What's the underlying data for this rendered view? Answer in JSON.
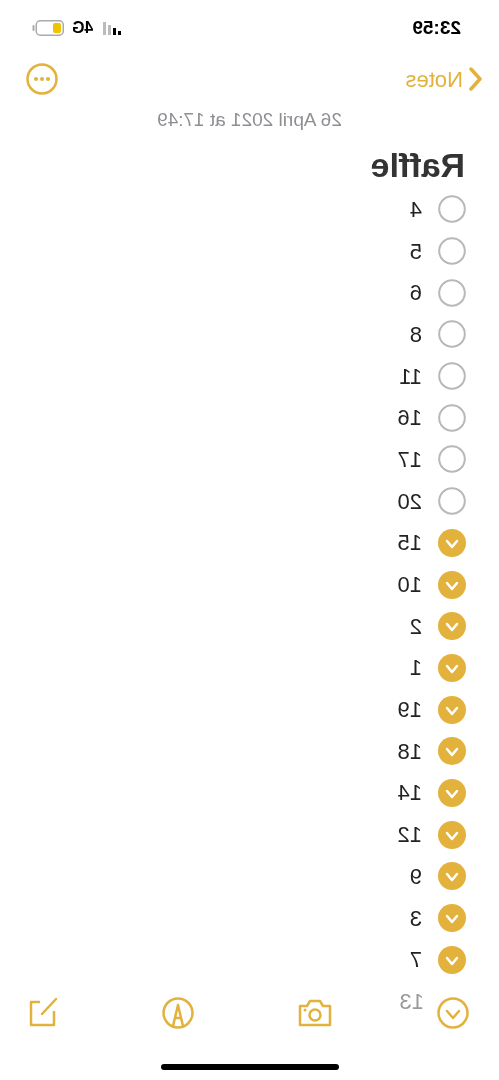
{
  "status_bar": {
    "time": "23:59",
    "network": "4G"
  },
  "nav": {
    "back_label": "Notes"
  },
  "note": {
    "date": "26 April 2021 at 17:49",
    "title": "Raffle",
    "items": [
      {
        "label": "4",
        "checked": false
      },
      {
        "label": "5",
        "checked": false
      },
      {
        "label": "6",
        "checked": false
      },
      {
        "label": "8",
        "checked": false
      },
      {
        "label": "11",
        "checked": false
      },
      {
        "label": "16",
        "checked": false
      },
      {
        "label": "17",
        "checked": false
      },
      {
        "label": "20",
        "checked": false
      },
      {
        "label": "15",
        "checked": true
      },
      {
        "label": "10",
        "checked": true
      },
      {
        "label": "2",
        "checked": true
      },
      {
        "label": "1",
        "checked": true
      },
      {
        "label": "19",
        "checked": true
      },
      {
        "label": "18",
        "checked": true
      },
      {
        "label": "14",
        "checked": true
      },
      {
        "label": "12",
        "checked": true
      },
      {
        "label": "9",
        "checked": true
      },
      {
        "label": "3",
        "checked": true
      },
      {
        "label": "7",
        "checked": true
      },
      {
        "label": "13",
        "kind": "obscured"
      }
    ]
  }
}
